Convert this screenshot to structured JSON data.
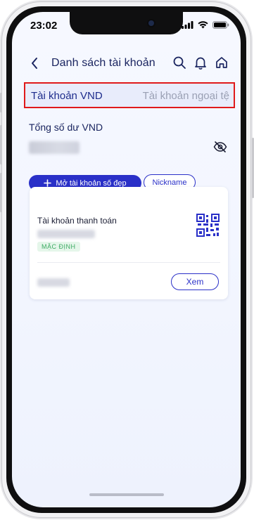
{
  "status_bar": {
    "time": "23:02"
  },
  "header": {
    "title": "Danh sách tài khoản"
  },
  "tabs": {
    "vnd": "Tài khoản VND",
    "foreign": "Tài khoản ngoại tệ",
    "active": "vnd"
  },
  "summary": {
    "total_label": "Tổng số dư VND"
  },
  "actions": {
    "open_account": "Mở tài khoản số đẹp",
    "nickname": "Nickname"
  },
  "account_card": {
    "title": "Tài khoản thanh toán",
    "badge": "MẶC ĐỊNH",
    "view_label": "Xem"
  },
  "colors": {
    "primary": "#2a30c8",
    "title": "#1a2560",
    "highlight_border": "#e01a1a",
    "badge_text": "#3cab62"
  }
}
